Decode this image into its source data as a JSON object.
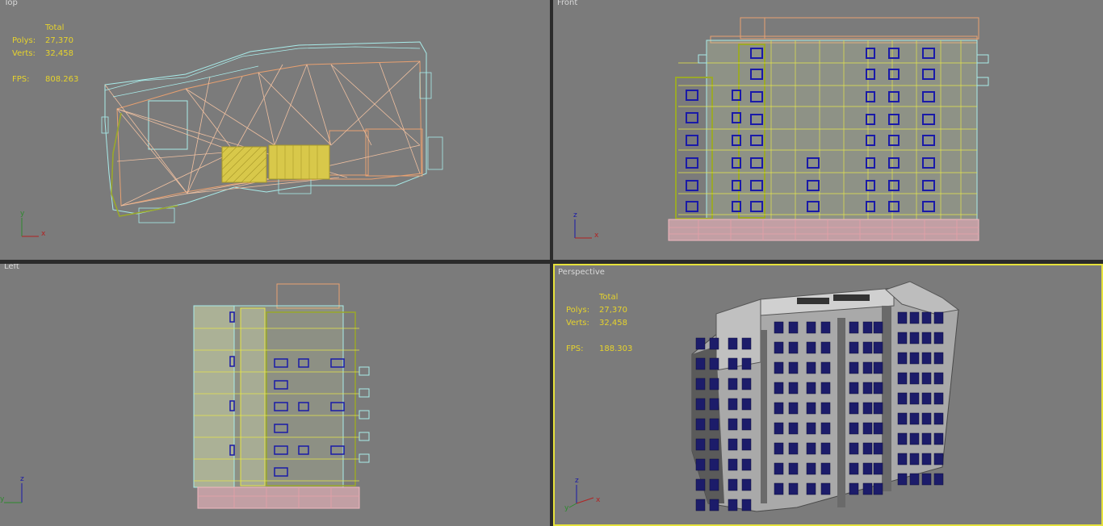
{
  "viewports": {
    "top": {
      "label": "Top",
      "stats": {
        "total": "Total",
        "polys_label": "Polys:",
        "polys": "27,370",
        "verts_label": "Verts:",
        "verts": "32,458",
        "fps_label": "FPS:",
        "fps": "808.263"
      },
      "axes": [
        "y",
        "x"
      ]
    },
    "front": {
      "label": "Front",
      "axes": [
        "z",
        "x"
      ]
    },
    "left": {
      "label": "Left",
      "axes": [
        "z",
        "y"
      ]
    },
    "perspective": {
      "label": "Perspective",
      "stats": {
        "total": "Total",
        "polys_label": "Polys:",
        "polys": "27,370",
        "verts_label": "Verts:",
        "verts": "32,458",
        "fps_label": "FPS:",
        "fps": "188.303"
      },
      "axes": [
        "z",
        "x",
        "y"
      ],
      "active": true
    }
  },
  "colors": {
    "viewport_bg": "#7b7b7b",
    "stats_text": "#e6d32c",
    "active_border": "#e6e23c",
    "wire_orange": "#e8a070",
    "wire_cyan": "#a8ecea",
    "wire_yellow": "#e6e64a",
    "wire_olive": "#9aa82a",
    "wire_pink": "#f2b8c0",
    "wire_blue": "#1a1aa8"
  }
}
